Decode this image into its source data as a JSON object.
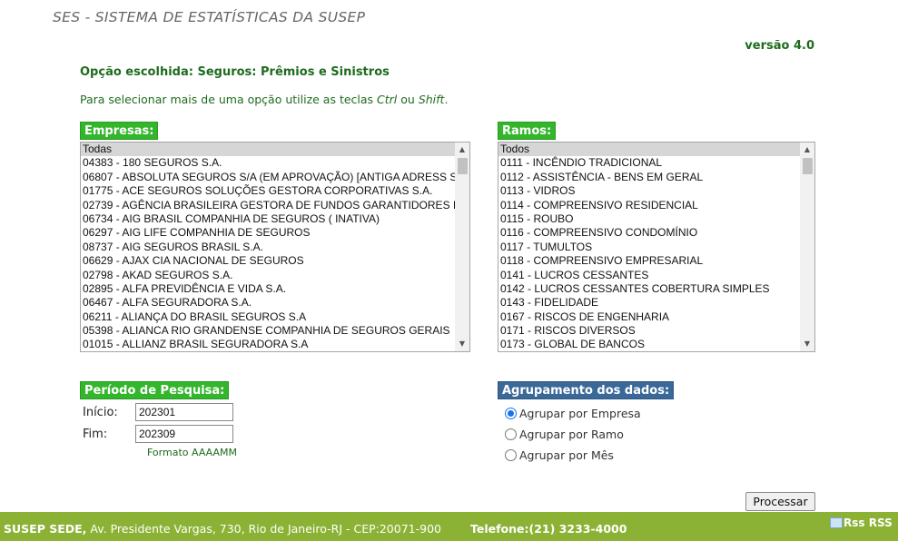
{
  "header": {
    "title": "SES - SISTEMA DE ESTATÍSTICAS DA SUSEP",
    "version": "versão 4.0",
    "chosen_option": "Opção escolhida: Seguros: Prêmios e Sinistros",
    "hint_prefix": "Para selecionar mais de uma opção utilize as teclas ",
    "hint_key1": "Ctrl",
    "hint_mid": " ou ",
    "hint_key2": "Shift",
    "hint_suffix": "."
  },
  "empresas": {
    "label": "Empresas:",
    "options": [
      "Todas",
      "04383 - 180 SEGUROS S.A.",
      "06807 - ABSOLUTA SEGUROS S/A (EM APROVAÇÃO) [ANTIGA ADRESS S",
      "01775 - ACE SEGUROS SOLUÇÕES GESTORA CORPORATIVAS S.A.",
      "02739 - AGÊNCIA BRASILEIRA GESTORA DE FUNDOS GARANTIDORES I",
      "06734 - AIG BRASIL COMPANHIA DE SEGUROS ( INATIVA)",
      "06297 - AIG LIFE COMPANHIA DE SEGUROS",
      "08737 - AIG SEGUROS BRASIL S.A.",
      "06629 - AJAX CIA NACIONAL DE SEGUROS",
      "02798 - AKAD SEGUROS S.A.",
      "02895 - ALFA PREVIDÊNCIA E VIDA S.A.",
      "06467 - ALFA SEGURADORA S.A.",
      "06211 - ALIANÇA DO BRASIL SEGUROS S.A",
      "05398 - ALIANCA RIO GRANDENSE COMPANHIA DE SEGUROS GERAIS",
      "01015 - ALLIANZ BRASIL SEGURADORA S.A"
    ]
  },
  "ramos": {
    "label": "Ramos:",
    "options": [
      "Todos",
      "0111 - INCÊNDIO TRADICIONAL",
      "0112 - ASSISTÊNCIA - BENS EM GERAL",
      "0113 - VIDROS",
      "0114 - COMPREENSIVO RESIDENCIAL",
      "0115 - ROUBO",
      "0116 - COMPREENSIVO CONDOMÍNIO",
      "0117 - TUMULTOS",
      "0118 - COMPREENSIVO EMPRESARIAL",
      "0141 - LUCROS CESSANTES",
      "0142 - LUCROS CESSANTES COBERTURA SIMPLES",
      "0143 - FIDELIDADE",
      "0167 - RISCOS DE ENGENHARIA",
      "0171 - RISCOS DIVERSOS",
      "0173 - GLOBAL DE BANCOS"
    ]
  },
  "periodo": {
    "label": "Período de Pesquisa:",
    "inicio_label": "Início:",
    "inicio_value": "202301",
    "fim_label": "Fim:",
    "fim_value": "202309",
    "format_hint": "Formato AAAAMM"
  },
  "agrupamento": {
    "label": "Agrupamento dos dados:",
    "options": [
      "Agrupar por Empresa",
      "Agrupar por Ramo",
      "Agrupar por Mês"
    ],
    "selected": "Agrupar por Empresa"
  },
  "submit_label": "Processar",
  "footer": {
    "addr_bold": "SUSEP SEDE,",
    "addr_rest": " Av. Presidente Vargas, 730, Rio de Janeiro-RJ  -  CEP:20071-900",
    "phone": "Telefone:(21) 3233-4000",
    "rss_alt": "Rss",
    "rss_label": "RSS"
  },
  "colors": {
    "green_label": "#33b52c",
    "blue_label": "#3a6898",
    "footer": "#8bb234",
    "text_green": "#1e6b1e"
  }
}
